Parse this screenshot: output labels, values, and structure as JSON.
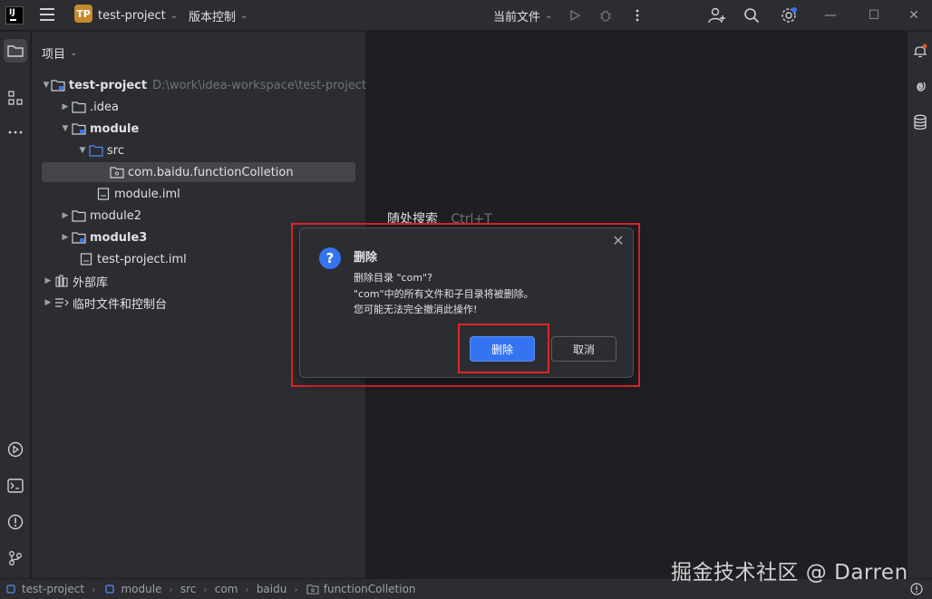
{
  "titlebar": {
    "logo_text": "IJ",
    "project_badge": "TP",
    "project_name": "test-project",
    "vcs_label": "版本控制",
    "run_config": "当前文件"
  },
  "project_panel": {
    "header": "项目",
    "tree": [
      {
        "label": "test-project",
        "path": "D:\\work\\idea-workspace\\test-project"
      },
      {
        "label": ".idea"
      },
      {
        "label": "module"
      },
      {
        "label": "src"
      },
      {
        "label": "com.baidu.functionColletion"
      },
      {
        "label": "module.iml"
      },
      {
        "label": "module2"
      },
      {
        "label": "module3"
      },
      {
        "label": "test-project.iml"
      },
      {
        "label": "外部库"
      },
      {
        "label": "临时文件和控制台"
      }
    ]
  },
  "editor": {
    "hint_text": "随处搜索",
    "hint_shortcut": "Ctrl+T"
  },
  "dialog": {
    "title": "删除",
    "line1": "删除目录 \"com\"?",
    "line2": "\"com\"中的所有文件和子目录将被删除。",
    "line3": "您可能无法完全撤消此操作!",
    "ok_label": "删除",
    "cancel_label": "取消"
  },
  "statusbar": {
    "crumbs": [
      "test-project",
      "module",
      "src",
      "com",
      "baidu",
      "functionColletion"
    ]
  },
  "watermark": "掘金技术社区 @ Darren",
  "colors": {
    "accent": "#3574f0",
    "highlight": "#e0242c",
    "badge": "#c7892c"
  }
}
